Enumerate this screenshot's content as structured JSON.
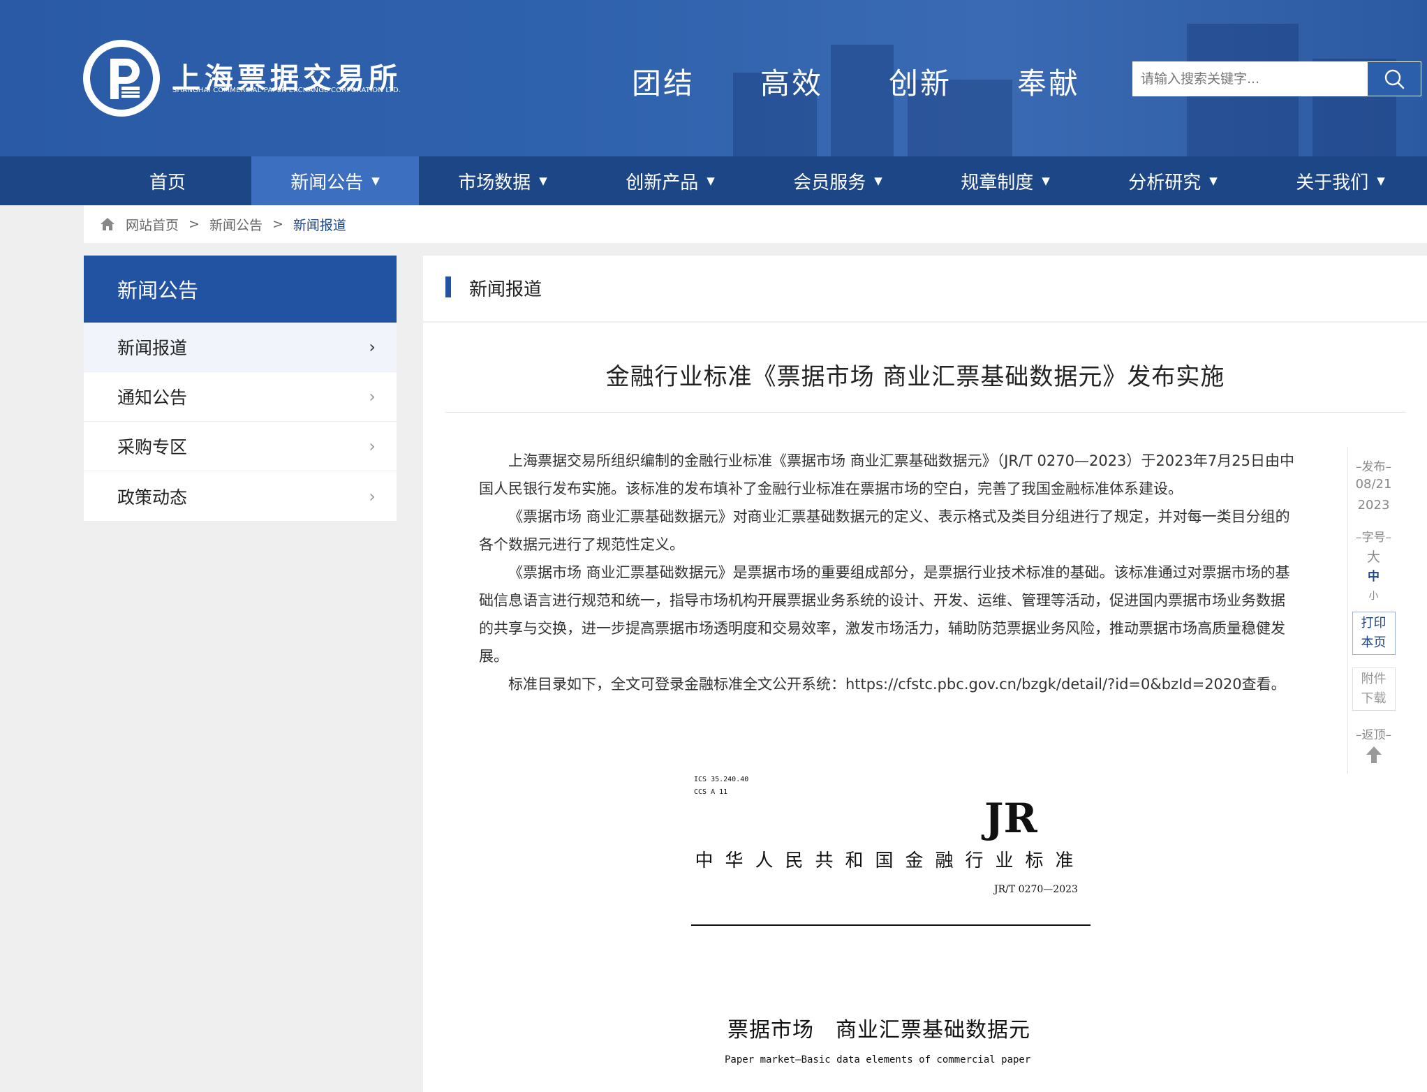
{
  "header": {
    "logo_cn": "上海票据交易所",
    "logo_en": "SHANGHAI COMMERCIAL PAPER EXCHANGE CORPORATION LTD.",
    "slogans": [
      "团结",
      "高效",
      "创新",
      "奉献"
    ],
    "search_placeholder": "请输入搜索关键字..."
  },
  "nav": {
    "items": [
      {
        "label": "首页",
        "dropdown": false
      },
      {
        "label": "新闻公告",
        "dropdown": true
      },
      {
        "label": "市场数据",
        "dropdown": true
      },
      {
        "label": "创新产品",
        "dropdown": true
      },
      {
        "label": "会员服务",
        "dropdown": true
      },
      {
        "label": "规章制度",
        "dropdown": true
      },
      {
        "label": "分析研究",
        "dropdown": true
      },
      {
        "label": "关于我们",
        "dropdown": true
      }
    ],
    "active_index": 1,
    "caret": "▼"
  },
  "breadcrumb": {
    "items": [
      "网站首页",
      "新闻公告",
      "新闻报道"
    ],
    "separator": ">"
  },
  "sidebar": {
    "title": "新闻公告",
    "items": [
      {
        "label": "新闻报道",
        "active": true
      },
      {
        "label": "通知公告",
        "active": false
      },
      {
        "label": "采购专区",
        "active": false
      },
      {
        "label": "政策动态",
        "active": false
      }
    ],
    "chevron": "›"
  },
  "main": {
    "section_title": "新闻报道",
    "article_title": "金融行业标准《票据市场 商业汇票基础数据元》发布实施",
    "paragraphs": [
      "上海票据交易所组织编制的金融行业标准《票据市场 商业汇票基础数据元》（JR/T 0270—2023）于2023年7月25日由中国人民银行发布实施。该标准的发布填补了金融行业标准在票据市场的空白，完善了我国金融标准体系建设。",
      "《票据市场 商业汇票基础数据元》对商业汇票基础数据元的定义、表示格式及类目分组进行了规定，并对每一类目分组的各个数据元进行了规范性定义。",
      "《票据市场 商业汇票基础数据元》是票据市场的重要组成部分，是票据行业技术标准的基础。该标准通过对票据市场的基础信息语言进行规范和统一，指导市场机构开展票据业务系统的设计、开发、运维、管理等活动，促进国内票据市场业务数据的共享与交换，进一步提高票据市场透明度和交易效率，激发市场活力，辅助防范票据业务风险，推动票据市场高质量稳健发展。",
      "标准目录如下，全文可登录金融标准全文公开系统：https://cfstc.pbc.gov.cn/bzgk/detail/?id=0&bzId=2020查看。"
    ]
  },
  "tools": {
    "publish_label": "–发布–",
    "publish_date": "08/21",
    "publish_year": "2023",
    "font_label": "–字号–",
    "font_sizes": [
      "大",
      "中",
      "小"
    ],
    "print_line1": "打印",
    "print_line2": "本页",
    "attach_line1": "附件",
    "attach_line2": "下载",
    "top_label": "–返顶–"
  },
  "document": {
    "ics": "ICS 35.240.40",
    "ccs": "CCS A 11",
    "logo": "JR",
    "standard_type": "中华人民共和国金融行业标准",
    "code": "JR/T 0270—2023",
    "name": "票据市场　商业汇票基础数据元",
    "name_en": "Paper market—Basic data elements of commercial paper"
  },
  "colors": {
    "header_blue": "#2f62ad",
    "nav_dark": "#1c4686",
    "nav_active": "#3c6fc0",
    "sidebar_title": "#2252a2"
  }
}
